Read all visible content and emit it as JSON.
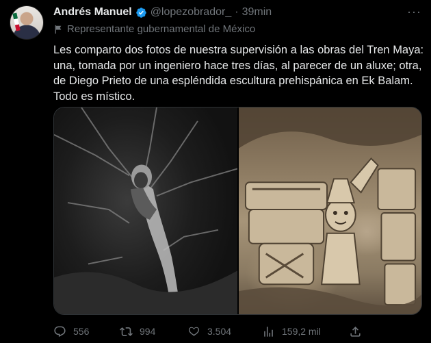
{
  "author": {
    "name": "Andrés Manuel",
    "handle": "@lopezobrador_",
    "separator": "·",
    "time": "39min",
    "label": "Representante gubernamental de México"
  },
  "tweet": {
    "text": "Les comparto dos fotos de nuestra supervisión a las obras del Tren Maya: una, tomada por un ingeniero hace tres días, al parecer de un aluxe; otra, de Diego Prieto de una espléndida escultura prehispánica en Ek Balam. Todo es místico."
  },
  "actions": {
    "replies": "556",
    "retweets": "994",
    "likes": "3.504",
    "views": "159,2 mil"
  },
  "icons": [
    "verified-badge-icon",
    "more-options-icon",
    "government-label-icon",
    "reply-icon",
    "retweet-icon",
    "like-icon",
    "views-icon",
    "share-icon"
  ],
  "colors": {
    "background": "#000000",
    "text": "#e7e9ea",
    "muted": "#71767b",
    "verified": "#1d9bf0"
  }
}
